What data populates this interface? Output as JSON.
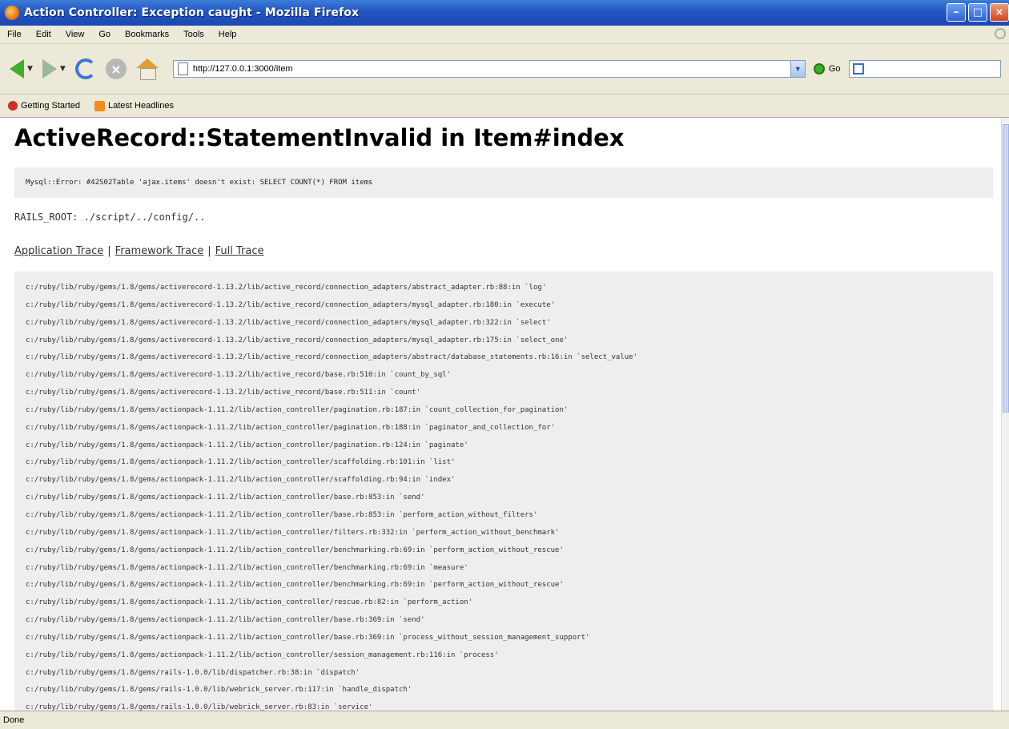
{
  "window": {
    "title": "Action Controller: Exception caught - Mozilla Firefox",
    "minimize": "–",
    "maximize": "□",
    "close": "×"
  },
  "menu": [
    "File",
    "Edit",
    "View",
    "Go",
    "Bookmarks",
    "Tools",
    "Help"
  ],
  "navbar": {
    "url": "http://127.0.0.1:3000/item",
    "go_label": "Go"
  },
  "bookmarks": [
    {
      "label": "Getting Started",
      "icon": "firefox-icon"
    },
    {
      "label": "Latest Headlines",
      "icon": "rss-icon"
    }
  ],
  "page": {
    "title": "ActiveRecord::StatementInvalid in Item#index",
    "error_message": "Mysql::Error: #42S02Table 'ajax.items' doesn't exist: SELECT COUNT(*) FROM items",
    "rails_root": "RAILS_ROOT: ./script/../config/..",
    "trace_links": [
      "Application Trace",
      "Framework Trace",
      "Full Trace"
    ],
    "trace_separator": "|",
    "trace": [
      "c:/ruby/lib/ruby/gems/1.8/gems/activerecord-1.13.2/lib/active_record/connection_adapters/abstract_adapter.rb:88:in `log'",
      "c:/ruby/lib/ruby/gems/1.8/gems/activerecord-1.13.2/lib/active_record/connection_adapters/mysql_adapter.rb:180:in `execute'",
      "c:/ruby/lib/ruby/gems/1.8/gems/activerecord-1.13.2/lib/active_record/connection_adapters/mysql_adapter.rb:322:in `select'",
      "c:/ruby/lib/ruby/gems/1.8/gems/activerecord-1.13.2/lib/active_record/connection_adapters/mysql_adapter.rb:175:in `select_one'",
      "c:/ruby/lib/ruby/gems/1.8/gems/activerecord-1.13.2/lib/active_record/connection_adapters/abstract/database_statements.rb:16:in `select_value'",
      "c:/ruby/lib/ruby/gems/1.8/gems/activerecord-1.13.2/lib/active_record/base.rb:510:in `count_by_sql'",
      "c:/ruby/lib/ruby/gems/1.8/gems/activerecord-1.13.2/lib/active_record/base.rb:511:in `count'",
      "c:/ruby/lib/ruby/gems/1.8/gems/actionpack-1.11.2/lib/action_controller/pagination.rb:187:in `count_collection_for_pagination'",
      "c:/ruby/lib/ruby/gems/1.8/gems/actionpack-1.11.2/lib/action_controller/pagination.rb:188:in `paginator_and_collection_for'",
      "c:/ruby/lib/ruby/gems/1.8/gems/actionpack-1.11.2/lib/action_controller/pagination.rb:124:in `paginate'",
      "c:/ruby/lib/ruby/gems/1.8/gems/actionpack-1.11.2/lib/action_controller/scaffolding.rb:101:in `list'",
      "c:/ruby/lib/ruby/gems/1.8/gems/actionpack-1.11.2/lib/action_controller/scaffolding.rb:94:in `index'",
      "c:/ruby/lib/ruby/gems/1.8/gems/actionpack-1.11.2/lib/action_controller/base.rb:853:in `send'",
      "c:/ruby/lib/ruby/gems/1.8/gems/actionpack-1.11.2/lib/action_controller/base.rb:853:in `perform_action_without_filters'",
      "c:/ruby/lib/ruby/gems/1.8/gems/actionpack-1.11.2/lib/action_controller/filters.rb:332:in `perform_action_without_benchmark'",
      "c:/ruby/lib/ruby/gems/1.8/gems/actionpack-1.11.2/lib/action_controller/benchmarking.rb:69:in `perform_action_without_rescue'",
      "c:/ruby/lib/ruby/gems/1.8/gems/actionpack-1.11.2/lib/action_controller/benchmarking.rb:69:in `measure'",
      "c:/ruby/lib/ruby/gems/1.8/gems/actionpack-1.11.2/lib/action_controller/benchmarking.rb:69:in `perform_action_without_rescue'",
      "c:/ruby/lib/ruby/gems/1.8/gems/actionpack-1.11.2/lib/action_controller/rescue.rb:82:in `perform_action'",
      "c:/ruby/lib/ruby/gems/1.8/gems/actionpack-1.11.2/lib/action_controller/base.rb:369:in `send'",
      "c:/ruby/lib/ruby/gems/1.8/gems/actionpack-1.11.2/lib/action_controller/base.rb:369:in `process_without_session_management_support'",
      "c:/ruby/lib/ruby/gems/1.8/gems/actionpack-1.11.2/lib/action_controller/session_management.rb:116:in `process'",
      "c:/ruby/lib/ruby/gems/1.8/gems/rails-1.0.0/lib/dispatcher.rb:38:in `dispatch'",
      "c:/ruby/lib/ruby/gems/1.8/gems/rails-1.0.0/lib/webrick_server.rb:117:in `handle_dispatch'",
      "c:/ruby/lib/ruby/gems/1.8/gems/rails-1.0.0/lib/webrick_server.rb:83:in `service'"
    ]
  },
  "status": "Done"
}
